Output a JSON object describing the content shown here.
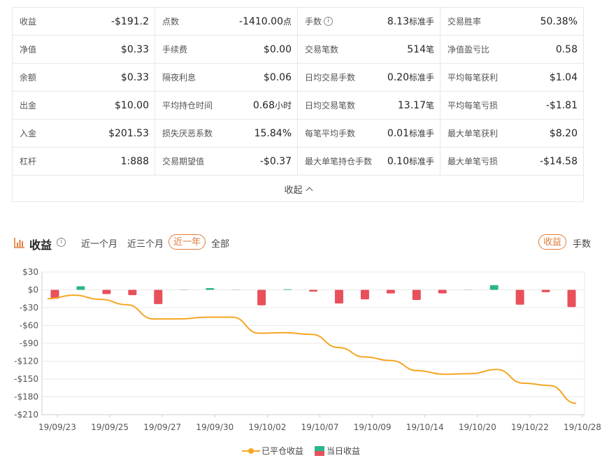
{
  "stats": [
    {
      "label": "收益",
      "value": "-$191.2",
      "unit": ""
    },
    {
      "label": "点数",
      "value": "-1410.00",
      "unit": "点"
    },
    {
      "label": "手数",
      "value": "8.13",
      "unit": "标准手",
      "info": true
    },
    {
      "label": "交易胜率",
      "value": "50.38%",
      "unit": ""
    },
    {
      "label": "净值",
      "value": "$0.33",
      "unit": ""
    },
    {
      "label": "手续费",
      "value": "$0.00",
      "unit": ""
    },
    {
      "label": "交易笔数",
      "value": "514",
      "unit": "笔"
    },
    {
      "label": "净值盈亏比",
      "value": "0.58",
      "unit": ""
    },
    {
      "label": "余额",
      "value": "$0.33",
      "unit": ""
    },
    {
      "label": "隔夜利息",
      "value": "$0.06",
      "unit": ""
    },
    {
      "label": "日均交易手数",
      "value": "0.20",
      "unit": "标准手"
    },
    {
      "label": "平均每笔获利",
      "value": "$1.04",
      "unit": ""
    },
    {
      "label": "出金",
      "value": "$10.00",
      "unit": ""
    },
    {
      "label": "平均持仓时间",
      "value": "0.68",
      "unit": "小时"
    },
    {
      "label": "日均交易笔数",
      "value": "13.17",
      "unit": "笔"
    },
    {
      "label": "平均每笔亏损",
      "value": "-$1.81",
      "unit": ""
    },
    {
      "label": "入金",
      "value": "$201.53",
      "unit": ""
    },
    {
      "label": "损失厌恶系数",
      "value": "15.84%",
      "unit": ""
    },
    {
      "label": "每笔平均手数",
      "value": "0.01",
      "unit": "标准手"
    },
    {
      "label": "最大单笔获利",
      "value": "$8.20",
      "unit": ""
    },
    {
      "label": "杠杆",
      "value": "1:888",
      "unit": ""
    },
    {
      "label": "交易期望值",
      "value": "-$0.37",
      "unit": ""
    },
    {
      "label": "最大单笔持仓手数",
      "value": "0.10",
      "unit": "标准手"
    },
    {
      "label": "最大单笔亏损",
      "value": "-$14.58",
      "unit": ""
    }
  ],
  "collapse_label": "收起",
  "section": {
    "title": "收益",
    "ranges": [
      "近一个月",
      "近三个月",
      "近一年",
      "全部"
    ],
    "active_range": "近一年",
    "toggles": [
      "收益",
      "手数"
    ],
    "active_toggle": "收益"
  },
  "colors": {
    "accent": "#e07b39",
    "line": "#f5a623",
    "bar_pos": "#2bb58a",
    "bar_neg": "#e8505b"
  },
  "chart_data": {
    "type": "bar+line",
    "y_ticks": [
      "$30",
      "$0",
      "-$30",
      "-$60",
      "-$90",
      "-$120",
      "-$150",
      "-$180",
      "-$210"
    ],
    "ylim": [
      -210,
      30
    ],
    "x_tick_labels": [
      "19/09/23",
      "19/09/25",
      "19/09/27",
      "19/09/30",
      "19/10/02",
      "19/10/07",
      "19/10/09",
      "19/10/14",
      "19/10/20",
      "19/10/22",
      "19/10/28"
    ],
    "series": [
      {
        "name": "已平仓收益",
        "type": "line",
        "values": [
          -15,
          -9,
          -16,
          -25,
          -49,
          -49,
          -46,
          -46,
          -73,
          -72,
          -75,
          -97,
          -113,
          -119,
          -136,
          -142,
          -141,
          -134,
          -157,
          -161,
          -191
        ]
      },
      {
        "name": "当日收益",
        "type": "bar",
        "values": [
          -15,
          6,
          -7,
          -9,
          -24,
          0,
          3,
          0,
          -26,
          1,
          -3,
          -23,
          -16,
          -6,
          -17,
          -6,
          0,
          8,
          -25,
          -4,
          -29
        ]
      }
    ],
    "legend": [
      "已平仓收益",
      "当日收益"
    ],
    "grid": true
  }
}
